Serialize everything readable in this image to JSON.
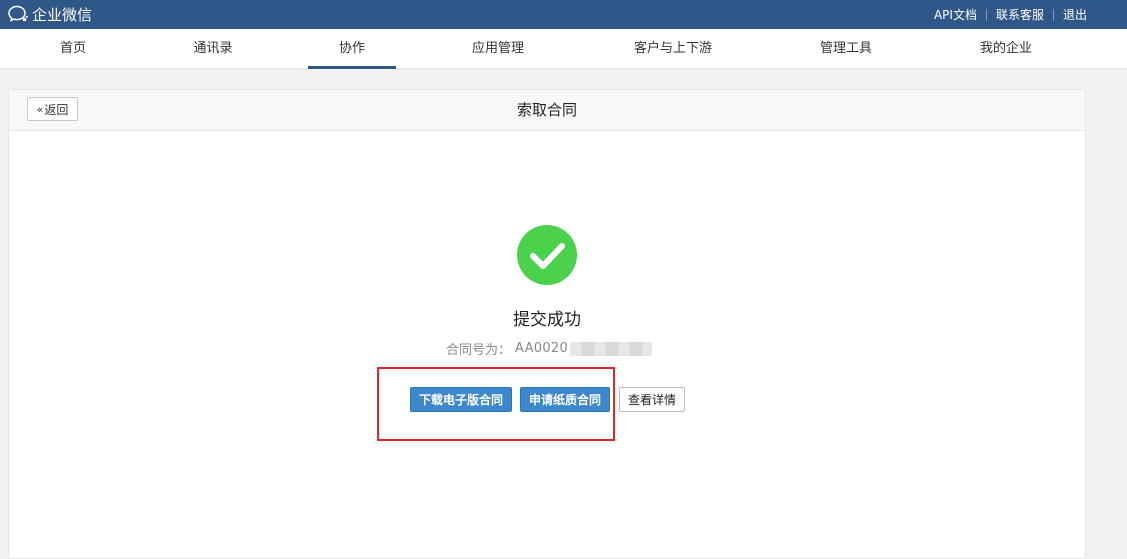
{
  "topbar": {
    "brand_text": "企业微信",
    "links": [
      "API文档",
      "联系客服",
      "退出"
    ]
  },
  "nav": {
    "items": [
      "首页",
      "通讯录",
      "协作",
      "应用管理",
      "客户与上下游",
      "管理工具",
      "我的企业"
    ],
    "active_index": 2
  },
  "card": {
    "back_label": "返回",
    "title": "索取合同",
    "success_text": "提交成功",
    "contract_label": "合同号为：",
    "contract_value": "AA0020",
    "buttons": {
      "download": "下载电子版合同",
      "apply_paper": "申请纸质合同",
      "view_detail": "查看详情"
    }
  },
  "colors": {
    "topbar": "#2f5787",
    "primary_button": "#3d87cc",
    "success": "#4cd14d",
    "highlight": "#d9272e"
  }
}
